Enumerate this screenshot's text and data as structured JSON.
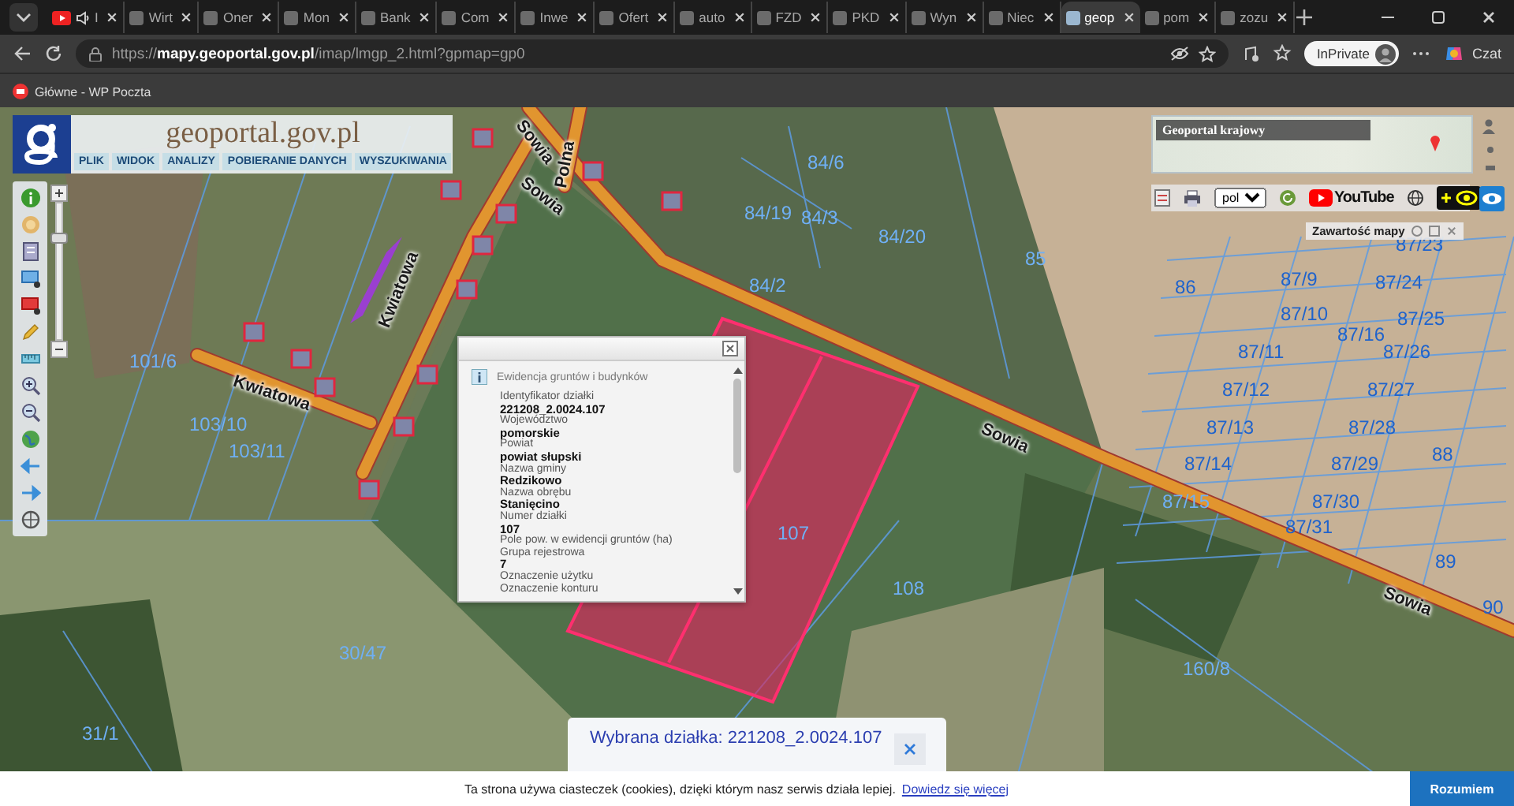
{
  "browser": {
    "tabs": [
      {
        "title": "I",
        "selected": false
      },
      {
        "title": "Wirt",
        "selected": false
      },
      {
        "title": "Oner",
        "selected": false
      },
      {
        "title": "Mon",
        "selected": false
      },
      {
        "title": "Bank",
        "selected": false
      },
      {
        "title": "Com",
        "selected": false
      },
      {
        "title": "Inwe",
        "selected": false
      },
      {
        "title": "Ofert",
        "selected": false
      },
      {
        "title": "auto",
        "selected": false
      },
      {
        "title": "FZD",
        "selected": false
      },
      {
        "title": "PKD",
        "selected": false
      },
      {
        "title": "Wyn",
        "selected": false
      },
      {
        "title": "Niec",
        "selected": false
      },
      {
        "title": "geop",
        "selected": true
      },
      {
        "title": "pom",
        "selected": false
      },
      {
        "title": "zozu",
        "selected": false
      }
    ],
    "url": "https://**mapy.geoportal.gov.pl**/imap/lmgp_2.html?gpmap=gp0",
    "profile": "InPrivate",
    "copilot": "Czat",
    "bookmarks": [
      {
        "label": "Główne - WP Poczta"
      }
    ]
  },
  "geoportal": {
    "logo": "geoportal.gov.pl",
    "menu": [
      "PLIK",
      "WIDOK",
      "ANALIZY",
      "POBIERANIE DANYCH",
      "WYSZUKIWANIA"
    ],
    "zoom_slider": {
      "level": 0.75
    },
    "overview": {
      "title": "Geoportal krajowy"
    },
    "language": "pol",
    "video_link": "YouTube",
    "map_contents": "Zawartość mapy"
  },
  "map": {
    "labels": [
      {
        "text": "Sowia",
        "kind": "road"
      },
      {
        "text": "Sowia",
        "kind": "road"
      },
      {
        "text": "Sowia",
        "kind": "road"
      },
      {
        "text": "Sowia",
        "kind": "road"
      },
      {
        "text": "Kwiatowa",
        "kind": "road"
      },
      {
        "text": "Kwiatowa",
        "kind": "road"
      },
      {
        "text": "Polna",
        "kind": "road"
      },
      {
        "text": "84/6",
        "kind": "parcel"
      },
      {
        "text": "84/19",
        "kind": "parcel"
      },
      {
        "text": "84/3",
        "kind": "parcel"
      },
      {
        "text": "84/2",
        "kind": "parcel"
      },
      {
        "text": "84/20",
        "kind": "parcel"
      },
      {
        "text": "85",
        "kind": "parcel"
      },
      {
        "text": "86",
        "kind": "parcel"
      },
      {
        "text": "87/9",
        "kind": "parcel"
      },
      {
        "text": "87/24",
        "kind": "parcel"
      },
      {
        "text": "87/23",
        "kind": "parcel"
      },
      {
        "text": "87/10",
        "kind": "parcel"
      },
      {
        "text": "87/16",
        "kind": "parcel"
      },
      {
        "text": "87/25",
        "kind": "parcel"
      },
      {
        "text": "87/11",
        "kind": "parcel"
      },
      {
        "text": "87/26",
        "kind": "parcel"
      },
      {
        "text": "87/12",
        "kind": "parcel"
      },
      {
        "text": "87/27",
        "kind": "parcel"
      },
      {
        "text": "87/13",
        "kind": "parcel"
      },
      {
        "text": "87/28",
        "kind": "parcel"
      },
      {
        "text": "87/14",
        "kind": "parcel"
      },
      {
        "text": "87/29",
        "kind": "parcel"
      },
      {
        "text": "87/15",
        "kind": "parcel"
      },
      {
        "text": "87/30",
        "kind": "parcel"
      },
      {
        "text": "87/31",
        "kind": "parcel"
      },
      {
        "text": "88",
        "kind": "parcel"
      },
      {
        "text": "89",
        "kind": "parcel"
      },
      {
        "text": "90",
        "kind": "parcel"
      },
      {
        "text": "160/8",
        "kind": "parcel"
      },
      {
        "text": "30/47",
        "kind": "parcel"
      },
      {
        "text": "31/1",
        "kind": "parcel"
      },
      {
        "text": "107",
        "kind": "parcel"
      },
      {
        "text": "108",
        "kind": "parcel"
      },
      {
        "text": "101/6",
        "kind": "parcel"
      },
      {
        "text": "103/10",
        "kind": "parcel"
      },
      {
        "text": "103/11",
        "kind": "parcel"
      }
    ]
  },
  "info_popup": {
    "title": "Ewidencja gruntów i budynków",
    "fields": [
      {
        "label": "Identyfikator działki",
        "value": "221208_2.0024.107"
      },
      {
        "label": "Województwo",
        "value": "pomorskie"
      },
      {
        "label": "Powiat",
        "value": "powiat słupski"
      },
      {
        "label": "Nazwa gminy",
        "value": "Redzikowo"
      },
      {
        "label": "Nazwa obrębu",
        "value": "Stanięcino"
      },
      {
        "label": "Numer działki",
        "value": "107"
      },
      {
        "label": "Pole pow. w ewidencji gruntów (ha)"
      },
      {
        "label": "Grupa rejestrowa",
        "value": "7"
      },
      {
        "label": "Oznaczenie użytku"
      },
      {
        "label": "Oznaczenie konturu"
      }
    ]
  },
  "selection_bar": {
    "text": "Wybrana działka: 221208_2.0024.107"
  },
  "cookie_bar": {
    "text": "Ta strona używa ciasteczek (cookies), dzięki którym nasz serwis działa lepiej.",
    "link": "Dowiedz się więcej",
    "button": "Rozumiem"
  }
}
